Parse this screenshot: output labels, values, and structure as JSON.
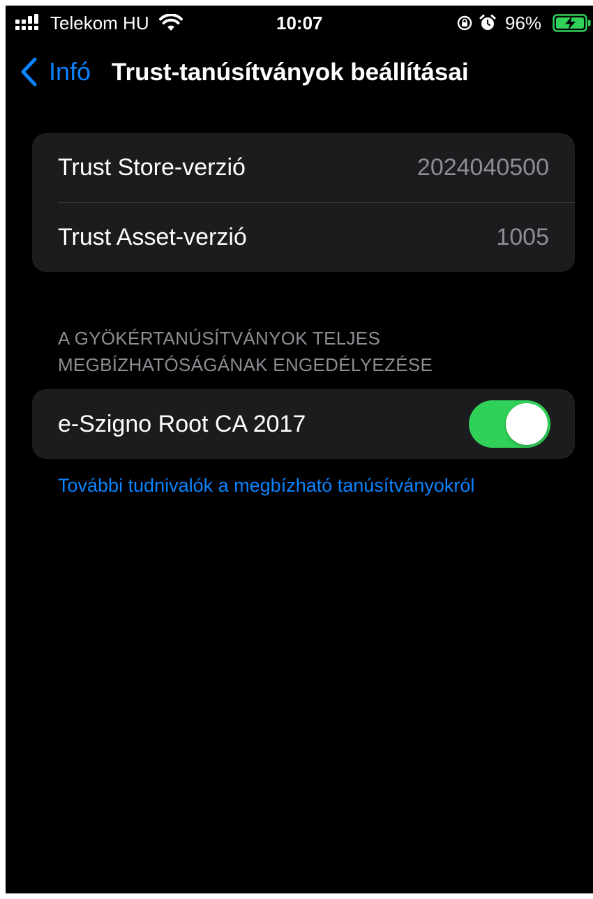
{
  "status_bar": {
    "carrier": "Telekom HU",
    "time": "10:07",
    "battery_percent": "96%",
    "icons": [
      "signal-icon",
      "wifi-icon",
      "orientation-lock-icon",
      "alarm-icon",
      "battery-charging-icon"
    ]
  },
  "nav": {
    "back_label": "Infó",
    "title": "Trust-tanúsítványok beállításai"
  },
  "versions": [
    {
      "label": "Trust Store-verzió",
      "value": "2024040500"
    },
    {
      "label": "Trust Asset-verzió",
      "value": "1005"
    }
  ],
  "cert_section": {
    "header_line1": "A GYÖKÉRTANÚSÍTVÁNYOK TELJES",
    "header_line2": "MEGBÍZHATÓSÁGÁNAK ENGEDÉLYEZÉSE",
    "items": [
      {
        "label": "e-Szigno Root CA 2017",
        "enabled": true
      }
    ]
  },
  "footer_link": "További tudnivalók a megbízható tanúsítványokról",
  "colors": {
    "background": "#000000",
    "group_background": "#1c1c1e",
    "accent": "#0a84ff",
    "toggle_on": "#30d158",
    "secondary_text": "#8d8d93"
  }
}
